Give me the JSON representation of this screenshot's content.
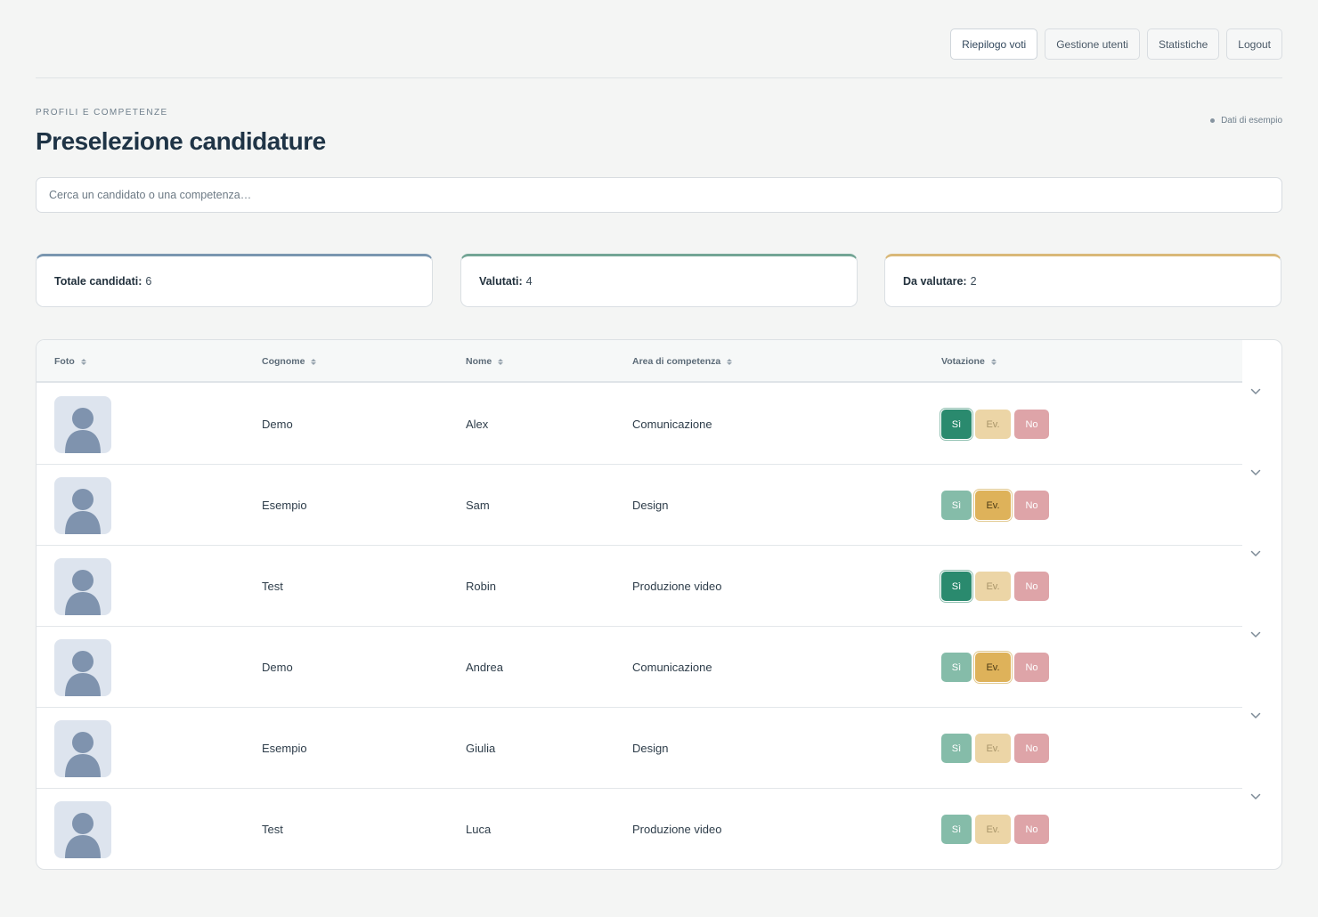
{
  "nav": {
    "items": [
      {
        "label": "Riepilogo voti",
        "active": true
      },
      {
        "label": "Gestione utenti",
        "active": false
      },
      {
        "label": "Statistiche",
        "active": false
      },
      {
        "label": "Logout",
        "active": false
      }
    ]
  },
  "header": {
    "eyebrow": "PROFILI E COMPETENZE",
    "title": "Preselezione candidature",
    "sample_note": "Dati di esempio"
  },
  "search": {
    "placeholder": "Cerca un candidato o una competenza…",
    "value": ""
  },
  "stats": [
    {
      "label": "Totale candidati:",
      "value": "6",
      "accent": "#7a96b0"
    },
    {
      "label": "Valutati:",
      "value": "4",
      "accent": "#73a595"
    },
    {
      "label": "Da valutare:",
      "value": "2",
      "accent": "#d9b878"
    }
  ],
  "table": {
    "columns": [
      "Foto",
      "Cognome",
      "Nome",
      "Area di competenza",
      "Votazione"
    ],
    "vote_labels": {
      "yes": "Sì",
      "maybe": "Ev.",
      "no": "No"
    },
    "rows": [
      {
        "photo_icon": "user-avatar-icon",
        "cognome": "Demo",
        "nome": "Alex",
        "area": "Comunicazione",
        "vote": "yes"
      },
      {
        "photo_icon": "user-avatar-icon",
        "cognome": "Esempio",
        "nome": "Sam",
        "area": "Design",
        "vote": "maybe"
      },
      {
        "photo_icon": "user-avatar-icon",
        "cognome": "Test",
        "nome": "Robin",
        "area": "Produzione video",
        "vote": "yes"
      },
      {
        "photo_icon": "user-avatar-icon",
        "cognome": "Demo",
        "nome": "Andrea",
        "area": "Comunicazione",
        "vote": "maybe"
      },
      {
        "photo_icon": "user-avatar-icon",
        "cognome": "Esempio",
        "nome": "Giulia",
        "area": "Design",
        "vote": null
      },
      {
        "photo_icon": "user-avatar-icon",
        "cognome": "Test",
        "nome": "Luca",
        "area": "Produzione video",
        "vote": null
      }
    ]
  },
  "colors": {
    "yes_selected": "#2a8a6e",
    "yes_idle": "#85bca9",
    "maybe_selected": "#deb25a",
    "maybe_idle": "#ecd5a6",
    "no_idle": "#dea4a8"
  }
}
